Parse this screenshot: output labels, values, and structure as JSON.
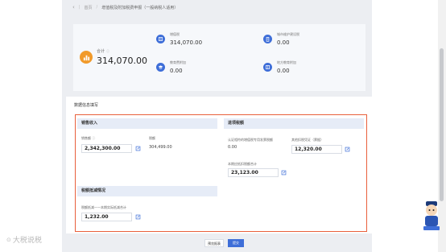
{
  "breadcrumb": {
    "home": "首页",
    "current": "增值税及附加税费申报（一般纳税人适用）"
  },
  "summary": {
    "total_label": "合计",
    "total_value": "314,070.00",
    "items": [
      {
        "label": "增值税",
        "value": "314,070.00"
      },
      {
        "label": "城市维护建设税",
        "value": "0.00"
      },
      {
        "label": "教育费附加",
        "value": "0.00"
      },
      {
        "label": "地方教育附加",
        "value": "0.00"
      }
    ]
  },
  "info": {
    "title": "数据信息填写",
    "sales": {
      "title": "销售收入",
      "sales_amount_label": "销售额",
      "sales_amount_value": "2,342,300.00",
      "tax_label": "税额",
      "tax_value": "304,499.00"
    },
    "reduction": {
      "title": "税额抵减情况",
      "deduct_label": "税额抵减——本期实际抵减合计",
      "deduct_value": "1,232.00"
    },
    "input_tax": {
      "title": "进项税额",
      "certified_label": "认证相符的增值税专用发票税额",
      "certified_value": "0.00",
      "other_label": "其他扣税凭证（票据）",
      "other_value": "12,320.00",
      "unpaid_label": "本期应抵扣税额合计",
      "unpaid_value": "23,123.00"
    }
  },
  "buttons": {
    "prev": "预览报表",
    "submit": "提交"
  },
  "watermark": "大税说税",
  "colors": {
    "primary": "#3e6ed8",
    "orange": "#f19a2a",
    "highlight_border": "#e9603c"
  }
}
